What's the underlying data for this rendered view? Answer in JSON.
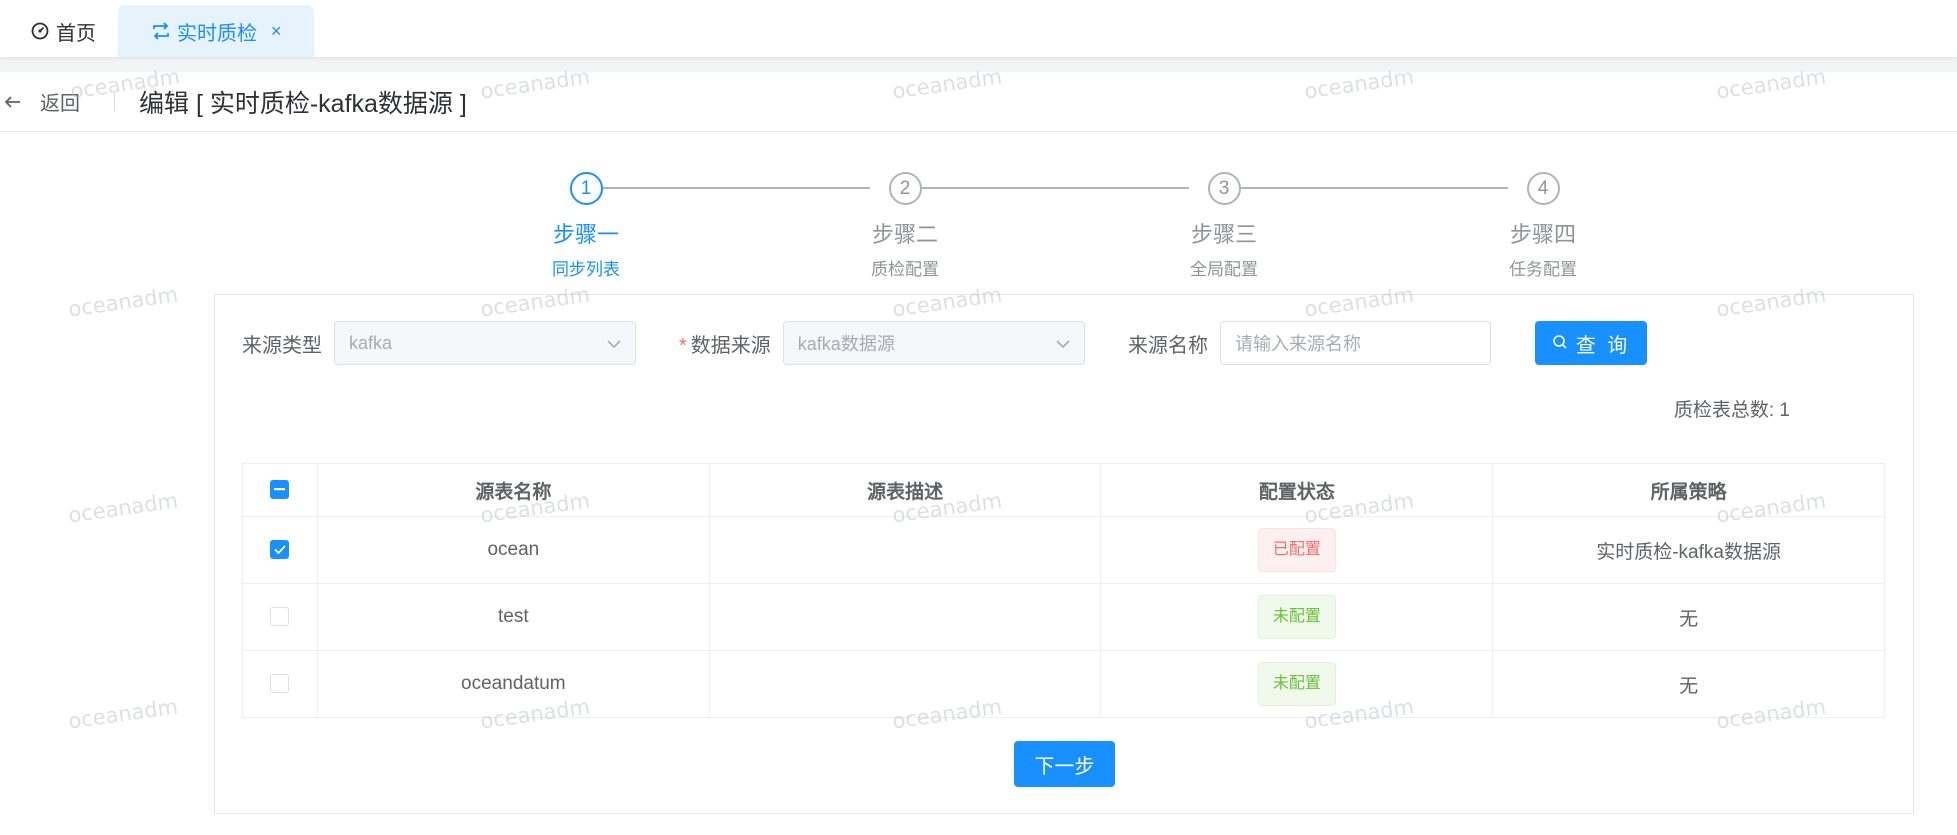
{
  "tabs": {
    "home_label": "首页",
    "active_label": "实时质检",
    "close_label": "×"
  },
  "header": {
    "back_label": "返回",
    "title": "编辑 [ 实时质检-kafka数据源 ]"
  },
  "steps": [
    {
      "number": "1",
      "title": "步骤一",
      "desc": "同步列表",
      "active": true
    },
    {
      "number": "2",
      "title": "步骤二",
      "desc": "质检配置",
      "active": false
    },
    {
      "number": "3",
      "title": "步骤三",
      "desc": "全局配置",
      "active": false
    },
    {
      "number": "4",
      "title": "步骤四",
      "desc": "任务配置",
      "active": false
    }
  ],
  "filters": {
    "source_type_label": "来源类型",
    "source_type_value": "kafka",
    "required_mark": "*",
    "data_source_label": "数据来源",
    "data_source_value": "kafka数据源",
    "source_name_label": "来源名称",
    "source_name_placeholder": "请输入来源名称",
    "query_label": "查 询"
  },
  "total": {
    "label": "质检表总数:",
    "value": "1"
  },
  "table": {
    "columns": [
      "源表名称",
      "源表描述",
      "配置状态",
      "所属策略"
    ],
    "rows": [
      {
        "checked": true,
        "name": "ocean",
        "desc": "",
        "status": "已配置",
        "status_type": "configured",
        "policy": "实时质检-kafka数据源"
      },
      {
        "checked": false,
        "name": "test",
        "desc": "",
        "status": "未配置",
        "status_type": "unconfigured",
        "policy": "无"
      },
      {
        "checked": false,
        "name": "oceandatum",
        "desc": "",
        "status": "未配置",
        "status_type": "unconfigured",
        "policy": "无"
      }
    ]
  },
  "next_label": "下一步",
  "watermark": "oceanadm",
  "colors": {
    "primary": "#1890ff",
    "configured": "#f56c6c",
    "unconfigured": "#67c23a"
  }
}
